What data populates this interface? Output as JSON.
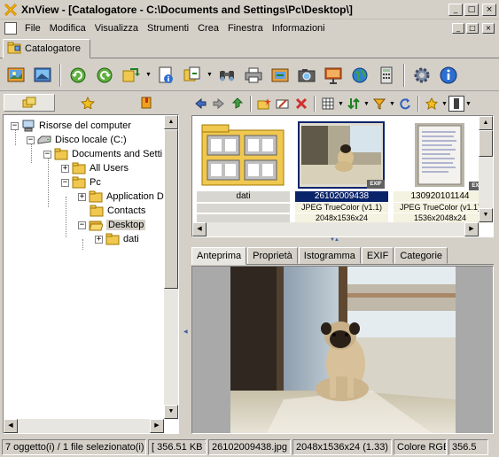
{
  "window": {
    "title": "XnView - [Catalogatore - C:\\Documents and Settings\\Pc\\Desktop\\]",
    "minimize_glyph": "_",
    "maximize_glyph": "□",
    "close_glyph": "×"
  },
  "menu": {
    "items": [
      "File",
      "Modifica",
      "Visualizza",
      "Strumenti",
      "Crea",
      "Finestra",
      "Informazioni"
    ]
  },
  "doc_tab": {
    "label": "Catalogatore"
  },
  "tree": {
    "nodes": [
      {
        "label": "Risorse del computer",
        "icon": "computer-icon",
        "expand": "−"
      },
      {
        "label": "Disco locale (C:)",
        "icon": "drive-icon",
        "expand": "−"
      },
      {
        "label": "Documents and Setti",
        "icon": "folder-icon",
        "expand": "−"
      },
      {
        "label": "All Users",
        "icon": "folder-icon",
        "expand": "+"
      },
      {
        "label": "Pc",
        "icon": "folder-icon",
        "expand": "−"
      },
      {
        "label": "Application D",
        "icon": "folder-icon",
        "expand": "+"
      },
      {
        "label": "Contacts",
        "icon": "folder-icon",
        "expand": ""
      },
      {
        "label": "Desktop",
        "icon": "folder-open-icon",
        "expand": "−",
        "selected": true
      },
      {
        "label": "dati",
        "icon": "folder-icon",
        "expand": "+"
      }
    ]
  },
  "thumbs": [
    {
      "name": "dati",
      "info1": "",
      "info2": "",
      "kind": "folder",
      "exif": ""
    },
    {
      "name": "26102009438",
      "info1": "JPEG TrueColor (v1.1)",
      "info2": "2048x1536x24",
      "kind": "photo",
      "exif": "EXIF",
      "selected": true
    },
    {
      "name": "130920101144",
      "info1": "JPEG TrueColor (v1.1)",
      "info2": "1536x2048x24",
      "kind": "document",
      "exif": "EXIF"
    }
  ],
  "preview_tabs": [
    "Anteprima",
    "Proprietà",
    "Istogramma",
    "EXIF",
    "Categorie"
  ],
  "status": {
    "count": "7 oggetto(i) / 1 file selezionato(i)",
    "size": "[ 356.51 KB ]",
    "filename": "26102009438.jpg",
    "dims": "2048x1536x24 (1.33)",
    "color": "Colore RGB",
    "extra": "356.5"
  },
  "colors": {
    "selection": "#0a246a",
    "folder": "#f0c850",
    "background": "#d4d0c8"
  }
}
